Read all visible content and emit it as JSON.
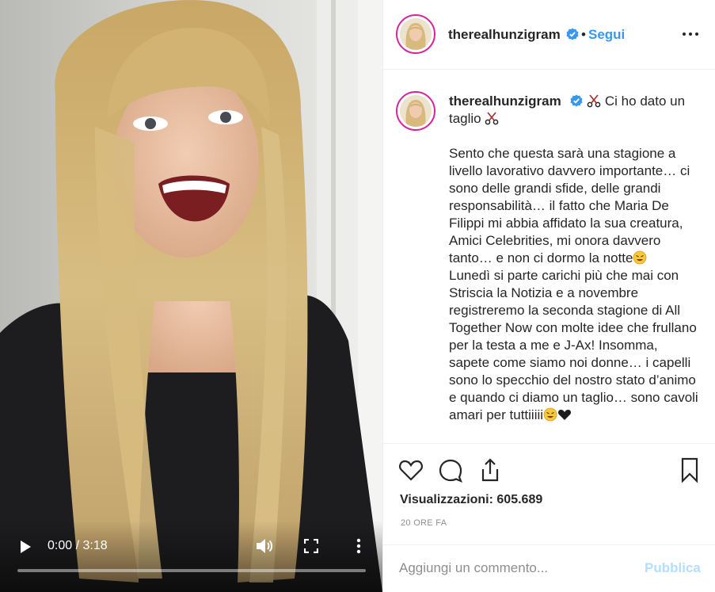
{
  "post": {
    "username": "therealhunzigram",
    "dot": "•",
    "follow_label": "Segui",
    "caption_title": "Ci ho dato un taglio",
    "caption_body": "Sento che questa sarà una stagione a livello lavorativo davvero importante… ci sono delle grandi sfide, delle grandi responsabilità… il fatto che Maria De Filippi mi abbia affidato la sua creatura, Amici Celebrities, mi onora davvero tanto… e non ci dormo la notte",
    "caption_body_2": "Lunedì si parte carichi più che mai con Striscia la Notizia e a novembre registreremo la seconda stagione di All Together Now con molte idee che frullano per la testa a me e J-Ax! Insomma, sapete come siamo noi donne… i capelli sono lo specchio del nostro stato d’animo e quando ci diamo un taglio… sono cavoli amari per tuttiiiii",
    "views_label": "Visualizzazioni: 605.689",
    "timestamp": "20 ORE FA"
  },
  "video": {
    "time_label": "0:00 / 3:18",
    "progress": 0.0
  },
  "composer": {
    "placeholder": "Aggiungi un commento...",
    "publish_label": "Pubblica"
  },
  "icons": {
    "verified": "verified-badge-icon",
    "scissors": "scissors-icon",
    "rofl": "rolling-laughing-emoji-icon",
    "heart_black": "black-heart-emoji-icon",
    "like": "heart-outline-icon",
    "comment": "speech-bubble-icon",
    "share": "share-upload-icon",
    "save": "bookmark-icon",
    "more": "more-options-icon"
  },
  "colors": {
    "accent": "#3897f0",
    "verified": "#3897f0",
    "publish_disabled": "#b2dffc",
    "muted": "#8e8e8e",
    "text": "#262626"
  }
}
